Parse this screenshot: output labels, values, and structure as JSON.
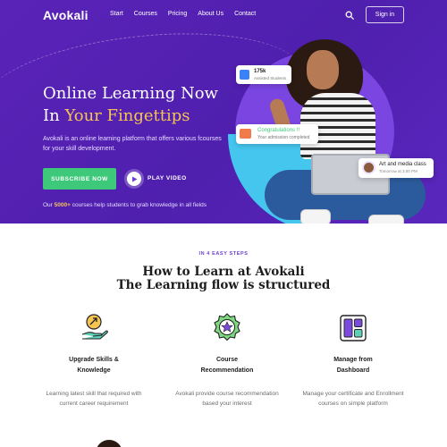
{
  "brand": {
    "logo": "Avokali"
  },
  "nav": {
    "links": [
      "Start",
      "Courses",
      "Pricing",
      "About Us",
      "Contact"
    ],
    "signin_label": "Sign in",
    "search_icon": "search-icon"
  },
  "hero": {
    "headline_line1": "Online Learning Now",
    "headline_in": "In ",
    "headline_accent": "Your Fingettips",
    "subtext": "Avokali is an online learning platform that offers various fcourses for your skill development.",
    "subscribe_label": "SUBSCRIBE NOW",
    "play_label": "PLAY VIDEO",
    "courses_prefix": "Our ",
    "courses_count": "5000+",
    "courses_suffix": " courses help students to grab knowledge in all fields"
  },
  "cards": {
    "students": {
      "value": "175k",
      "label": "Assisted Students"
    },
    "congrats": {
      "title": "Congratulations !!",
      "subtitle": "Your admission completed"
    },
    "class": {
      "title": "Art and media class",
      "time": "Tomorrow at 3.00 PM"
    }
  },
  "steps": {
    "kicker": "IN 4 EASY STEPS",
    "title_line1": "How to Learn at Avokali",
    "title_line2": "The Learning flow is structured",
    "items": [
      {
        "title_line1": "Upgrade Skills &",
        "title_line2": "Knowledge",
        "desc_line1": "Learning latest skill that required with",
        "desc_line2": "current career requirement",
        "icon": "upgrade-hand-icon"
      },
      {
        "title_line1": "Course",
        "title_line2": "Recommendation",
        "desc_line1": "Avokali provide course recommendation",
        "desc_line2": "based your interest",
        "icon": "badge-star-icon"
      },
      {
        "title_line1": "Manage from",
        "title_line2": "Dashboard",
        "desc_line1": "Manage your certificate and Enrollment",
        "desc_line2": "courses on simple platform",
        "icon": "dashboard-grid-icon"
      }
    ]
  },
  "colors": {
    "hero_bg": "#5a23b8",
    "accent_yellow": "#f6c453",
    "accent_green": "#3ec97a",
    "accent_purple": "#6d3fd6"
  }
}
